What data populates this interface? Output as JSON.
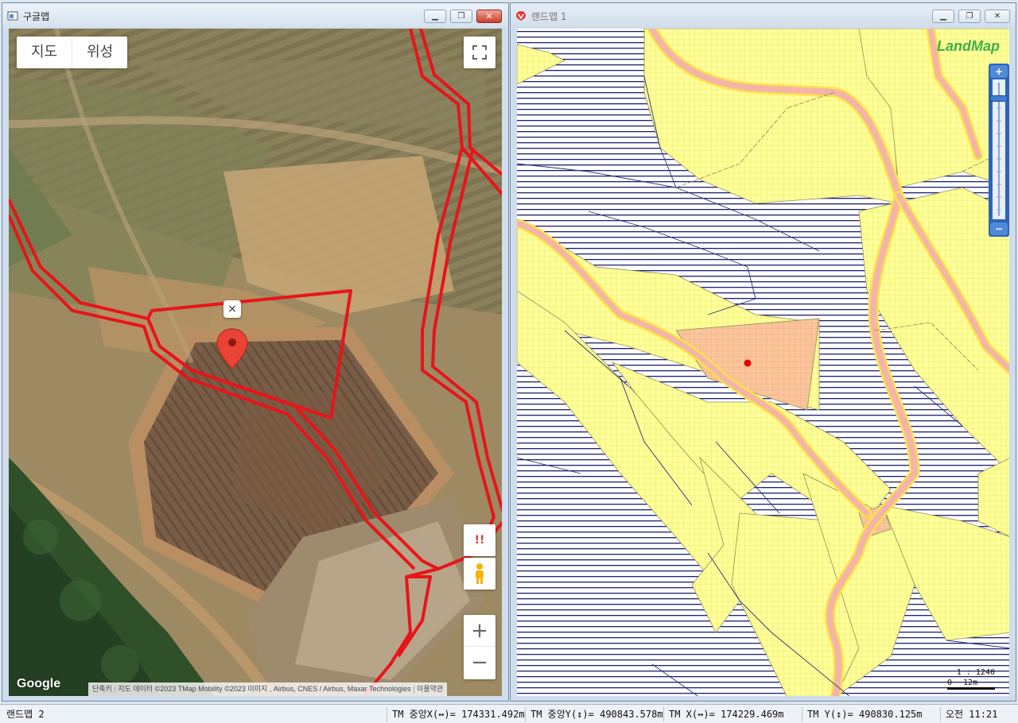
{
  "google_window": {
    "title": "구글맵",
    "map_type": [
      "지도",
      "위성"
    ],
    "logo": "Google",
    "attribution": {
      "shortcuts": "단축키",
      "data": "지도 데이터 ©2023 TMap Mobility ©2023 이미지 , Airbus, CNES / Airbus, Maxar Technologies",
      "terms": "이용약관"
    },
    "report_label": "!!",
    "marker_close": "×",
    "zoom_in": "+",
    "zoom_out": "−"
  },
  "landmap_window": {
    "title": "랜드맵 1",
    "logo": "LandMap",
    "scale_ratio": "1 : 1240",
    "scale_zero": "0",
    "scale_length": "12m"
  },
  "status_bar": {
    "window_label": "랜드맵 2",
    "tm_center_x": "TM 중앙X(↔)= 174331.492m",
    "tm_center_y": "TM 중앙Y(↕)= 490843.578m",
    "tm_x": "TM X(↔)= 174229.469m",
    "tm_y": "TM Y(↕)= 490830.125m",
    "clock": "오전 11:21"
  },
  "colors": {
    "parcel_red": "#e8141a",
    "land_yellow": "#ffff9a",
    "road_pink": "#f3b5a8",
    "selected_parcel": "#f9c59b",
    "hatch_navy": "#1c2170",
    "landmap_green": "#3db04a"
  }
}
